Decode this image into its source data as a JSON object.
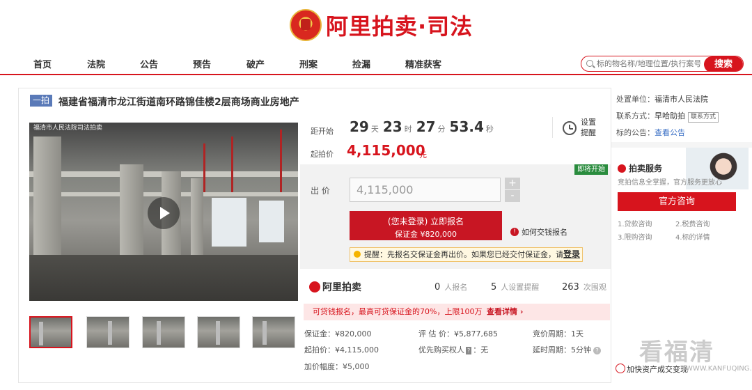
{
  "header": {
    "brand": "阿里拍卖·司法"
  },
  "nav": [
    {
      "label": "首页"
    },
    {
      "label": "法院"
    },
    {
      "label": "公告"
    },
    {
      "label": "预告"
    },
    {
      "label": "破产"
    },
    {
      "label": "刑案"
    },
    {
      "label": "捡漏"
    },
    {
      "label": "精准获客"
    }
  ],
  "search": {
    "placeholder": "标的物名称/地理位置/执行案号",
    "button": "搜索"
  },
  "item": {
    "tag": "一拍",
    "title": "福建省福清市龙江街道南环路锦佳楼2层商场商业房地产",
    "video_watermark": "福清市人民法院司法拍卖"
  },
  "countdown": {
    "label": "距开始",
    "days": "29",
    "days_unit": "天",
    "hours": "23",
    "hours_unit": "时",
    "minutes": "27",
    "minutes_unit": "分",
    "seconds": "53.4",
    "seconds_unit": "秒",
    "reminder": "设置提醒"
  },
  "price": {
    "start_label": "起拍价",
    "start_value": "4,115,000",
    "unit": "元"
  },
  "bid": {
    "soon_badge": "即将开始",
    "label": "出 价",
    "value": "4,115,000",
    "plus": "+",
    "minus": "-",
    "signup_line1": "(您未登录) 立即报名",
    "signup_line2": "保证金 ¥820,000",
    "howpay": "如何交钱报名",
    "tip_text": "提醒：先报名交保证金再出价。如果您已经交付保证金，请",
    "tip_login": "登录"
  },
  "stats": {
    "brand": "阿里拍卖",
    "signups": "0",
    "signups_label": "人报名",
    "reminders": "5",
    "reminders_label": "人设置提醒",
    "views": "263",
    "views_label": "次围观"
  },
  "loan": {
    "text": "可贷钱报名，最高可贷保证金的70%，上限100万",
    "link": "查看详情 ›"
  },
  "info": {
    "deposit": "保证金：¥820,000",
    "estimate": "评 估 价：¥5,877,685",
    "cycle": "竞价周期：1天",
    "start": "起拍价：¥4,115,000",
    "priority_prefix": "优先购买权人",
    "priority_tag": "?",
    "priority_value": "：无",
    "delay": "延时周期：5分钟",
    "increment": "加价幅度：¥5,000"
  },
  "sidebar": {
    "unit_label": "处置单位：",
    "unit_value": "福清市人民法院",
    "contact_label": "联系方式：",
    "contact_value": "早哈助拍",
    "contact_btn": "联系方式",
    "notice_label": "标的公告：",
    "notice_link": "查看公告",
    "service_title": "拍卖服务",
    "service_sub": "竞拍信息全掌握，官方服务更放心",
    "consult": "官方咨询",
    "links": [
      "1.贷款咨询",
      "2.税费咨询",
      "3.限购咨询",
      "4.标的详情"
    ],
    "bottom": "加快资产成交变现"
  },
  "watermark": {
    "text": "看福清",
    "sub": "WWW.KANFUQING.COM"
  }
}
